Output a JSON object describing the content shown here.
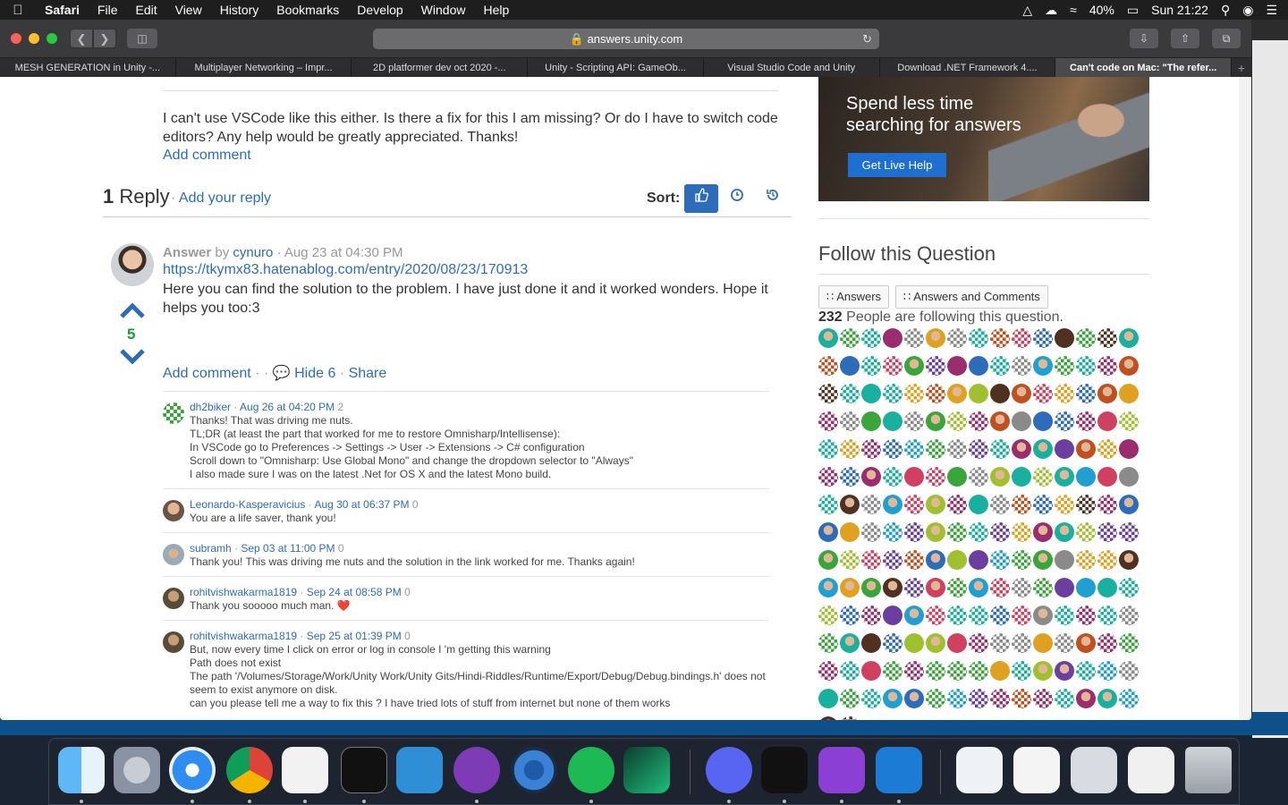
{
  "menubar": {
    "app": "Safari",
    "items": [
      "File",
      "Edit",
      "View",
      "History",
      "Bookmarks",
      "Develop",
      "Window",
      "Help"
    ],
    "battery": "40%",
    "clock": "Sun 21:22"
  },
  "browser": {
    "url": "answers.unity.com",
    "tabs": [
      "MESH GENERATION in Unity -...",
      "Multiplayer Networking – Impr...",
      "2D platformer dev oct 2020 -...",
      "Unity - Scripting API: GameOb...",
      "Visual Studio Code and Unity",
      "Download .NET Framework 4....",
      "Can't code on Mac: \"The refer..."
    ],
    "active_tab_index": 6
  },
  "question": {
    "text": "I can't use VSCode like this either. Is there a fix for this I am missing? Or do I have to switch code editors? Any help would be greatly appreciated. Thanks!",
    "add_comment": "Add comment"
  },
  "replies": {
    "count": "1",
    "label": "Reply",
    "add_reply": "Add your reply",
    "sort_label": "Sort:"
  },
  "answer": {
    "label": "Answer",
    "by": "by",
    "author": "cynuro",
    "date": "· Aug 23 at 04:30 PM",
    "url": "https://tkymx83.hatenablog.com/entry/2020/08/23/170913",
    "text": "Here you can find the solution to the problem. I have just done it and it worked wonders. Hope it helps you too:3",
    "votes": "5",
    "add_comment": "Add comment",
    "hide": "Hide 6",
    "share": "Share"
  },
  "comments": [
    {
      "user": "dh2biker",
      "date": "Aug 26 at 04:20 PM",
      "votes": "2",
      "body": "Thanks! That was driving me nuts.\nTL;DR (at least the part that worked for me to restore Omnisharp/Intellisense):\nIn VSCode go to Preferences -> Settings -> User -> Extensions -> C# configuration\nScroll down to \"Omnisharp: Use Global Mono\" and change the dropdown selector to \"Always\"\nI also made sure I was on the latest .Net for OS X and the latest Mono build.",
      "avatar_color": "#3aa53a"
    },
    {
      "user": "Leonardo-Kasperavicius",
      "date": "Aug 30 at 06:37 PM",
      "votes": "0",
      "body": "You are a life saver, thank you!",
      "avatar_color": "#b08a6e"
    },
    {
      "user": "subramh",
      "date": "Sep 03 at 11:00 PM",
      "votes": "0",
      "body": "Thank you! This was driving me nuts and the solution in the link worked for me. Thanks again!",
      "avatar_color": "#c9a37a"
    },
    {
      "user": "rohitvishwakarma1819",
      "date": "Sep 24 at 08:58 PM",
      "votes": "0",
      "body": "Thank you sooooo much man. ❤️",
      "avatar_color": "#8a7a5a"
    },
    {
      "user": "rohitvishwakarma1819",
      "date": "Sep 25 at 01:39 PM",
      "votes": "0",
      "body": "But, now every time I click on error or log in console I 'm getting this warning\nPath does not exist\nThe path '/Volumes/Storage/Work/Unity Work/Unity Gits/Hindi-Riddles/Runtime/Export/Debug/Debug.bindings.h' does not seem to exist anymore on disk.\ncan you please tell me a way to fix this ? I have tried lots of stuff from internet but none of them works",
      "avatar_color": "#8a7a5a"
    }
  ],
  "sidebar": {
    "promo_title": "Spend less time searching for answers",
    "promo_button": "Get Live Help",
    "follow_title": "Follow this Question",
    "follow_answers": "Answers",
    "follow_answers_comments": "Answers and Comments",
    "followers_count": "232",
    "followers_text": "People are following this question."
  },
  "colors": {
    "link": "#2d6cbb",
    "vote_count": "#1a9b3c",
    "promo_button": "#1f6fd1"
  }
}
